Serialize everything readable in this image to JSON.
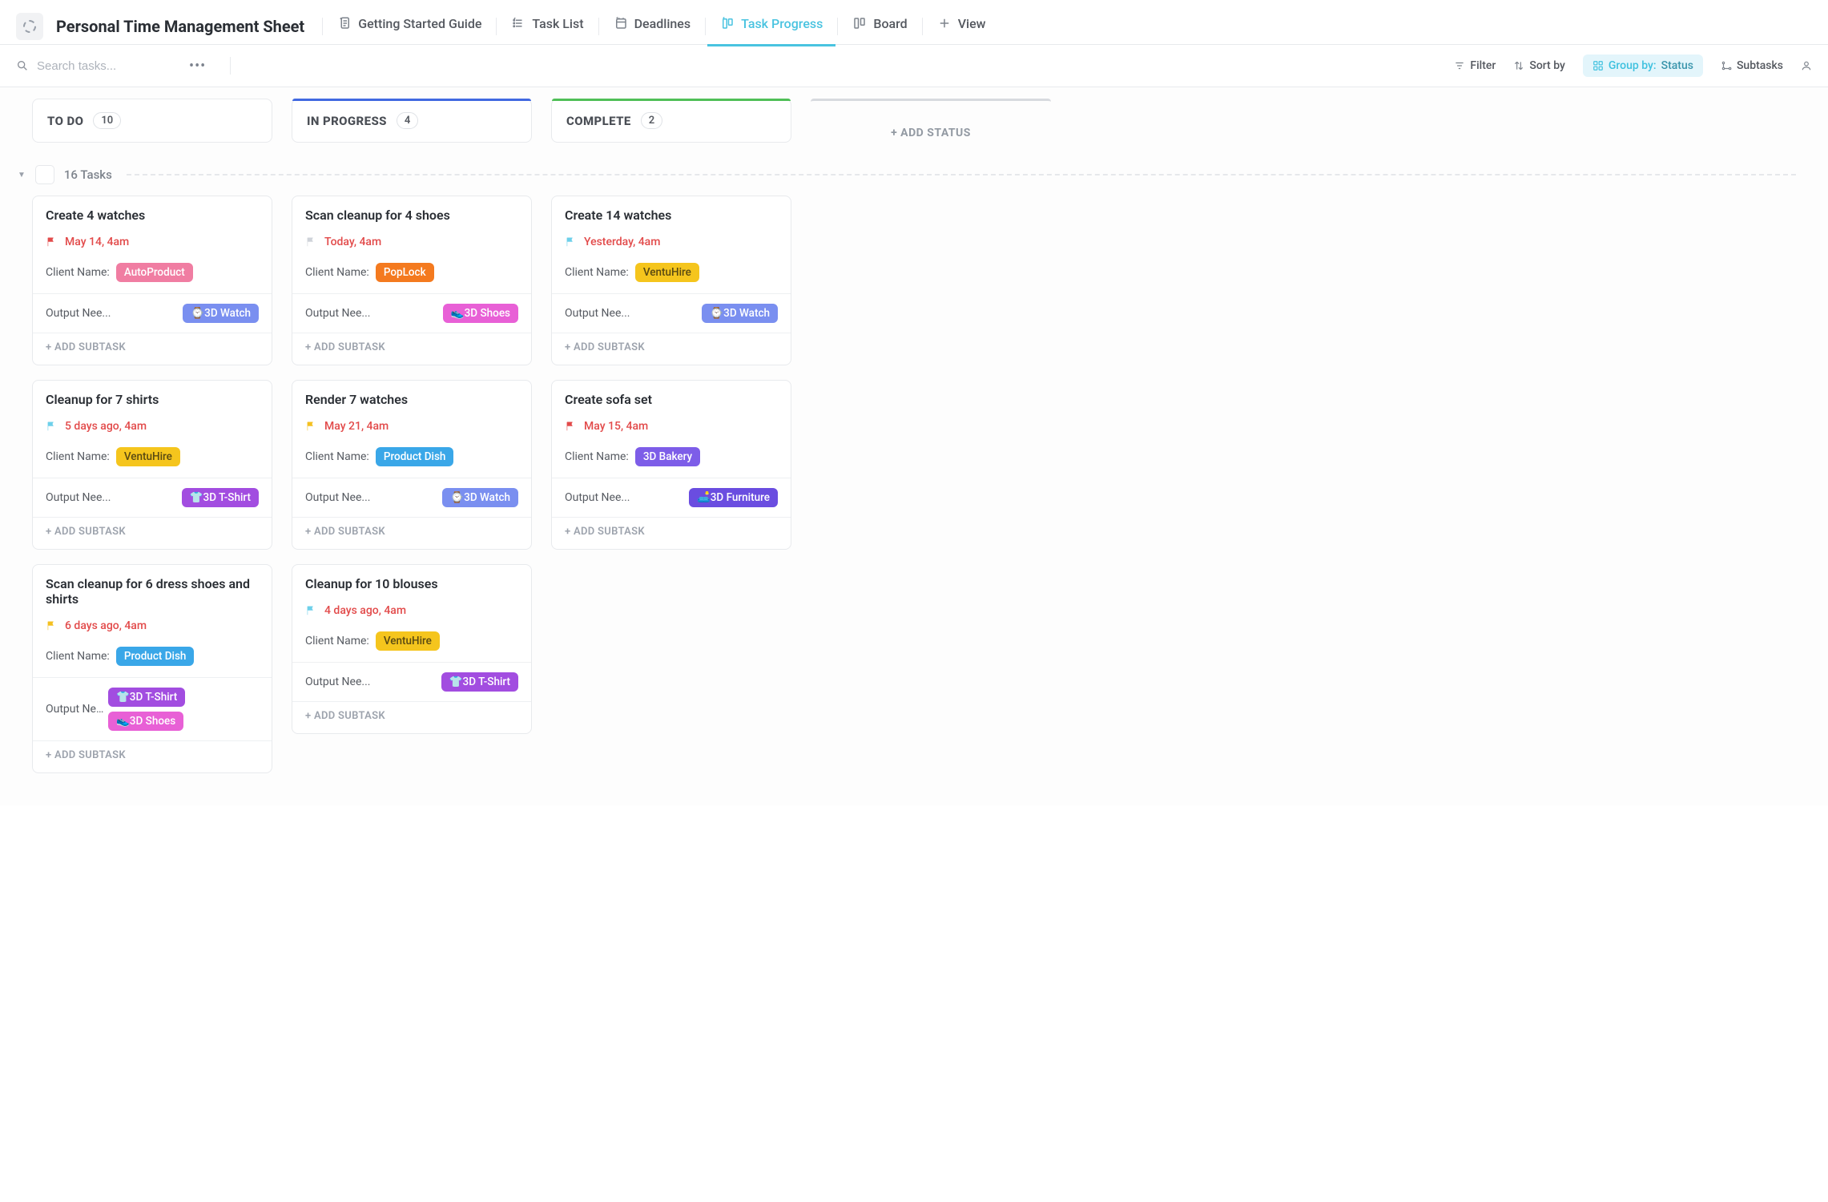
{
  "header": {
    "title": "Personal Time Management Sheet",
    "tabs": [
      {
        "label": "Getting Started Guide"
      },
      {
        "label": "Task List"
      },
      {
        "label": "Deadlines"
      },
      {
        "label": "Task Progress"
      },
      {
        "label": "Board"
      }
    ],
    "add_view": "View"
  },
  "toolbar": {
    "search_placeholder": "Search tasks...",
    "filter": "Filter",
    "sortby": "Sort by",
    "groupby_label": "Group by:",
    "groupby_value": "Status",
    "subtasks": "Subtasks"
  },
  "columns": [
    {
      "name": "TO DO",
      "count": "10"
    },
    {
      "name": "IN PROGRESS",
      "count": "4"
    },
    {
      "name": "COMPLETE",
      "count": "2"
    }
  ],
  "add_status": "+ ADD STATUS",
  "group": {
    "label": "16 Tasks"
  },
  "labels": {
    "client_name": "Client Name:",
    "output_needed": "Output Nee...",
    "add_subtask": "+ ADD SUBTASK"
  },
  "pill_colors": {
    "AutoProduct": "#f07da2",
    "PopLock": "#f47a1f",
    "VentuHire": "#f5c51d",
    "Product Dish": "#3aa7e8",
    "3D Bakery": "#7d5de8",
    "3D Watch": "#7a8ff0",
    "3D Shoes": "#e860d6",
    "3D T-Shirt": "#a24de0",
    "3D Furniture": "#6a4de0"
  },
  "emoji": {
    "3D Watch": "⌚",
    "3D Shoes": "👟",
    "3D T-Shirt": "👕",
    "3D Furniture": "🛋️"
  },
  "cards": {
    "todo": [
      {
        "title": "Create 4 watches",
        "flag": "red",
        "date": "May 14, 4am",
        "client": "AutoProduct",
        "outputs": [
          "3D Watch"
        ]
      },
      {
        "title": "Cleanup for 7 shirts",
        "flag": "cyan",
        "date": "5 days ago, 4am",
        "client": "VentuHire",
        "outputs": [
          "3D T-Shirt"
        ]
      },
      {
        "title": "Scan cleanup for 6 dress shoes and shirts",
        "flag": "yellow",
        "date": "6 days ago, 4am",
        "client": "Product Dish",
        "outputs": [
          "3D T-Shirt",
          "3D Shoes"
        ]
      }
    ],
    "inprogress": [
      {
        "title": "Scan cleanup for 4 shoes",
        "flag": "grey",
        "date": "Today, 4am",
        "client": "PopLock",
        "outputs": [
          "3D Shoes"
        ]
      },
      {
        "title": "Render 7 watches",
        "flag": "yellow",
        "date": "May 21, 4am",
        "client": "Product Dish",
        "outputs": [
          "3D Watch"
        ]
      },
      {
        "title": "Cleanup for 10 blouses",
        "flag": "cyan",
        "date": "4 days ago, 4am",
        "client": "VentuHire",
        "outputs": [
          "3D T-Shirt"
        ]
      }
    ],
    "complete": [
      {
        "title": "Create 14 watches",
        "flag": "cyan",
        "date": "Yesterday, 4am",
        "client": "VentuHire",
        "outputs": [
          "3D Watch"
        ]
      },
      {
        "title": "Create sofa set",
        "flag": "red",
        "date": "May 15, 4am",
        "client": "3D Bakery",
        "outputs": [
          "3D Furniture"
        ]
      }
    ]
  }
}
